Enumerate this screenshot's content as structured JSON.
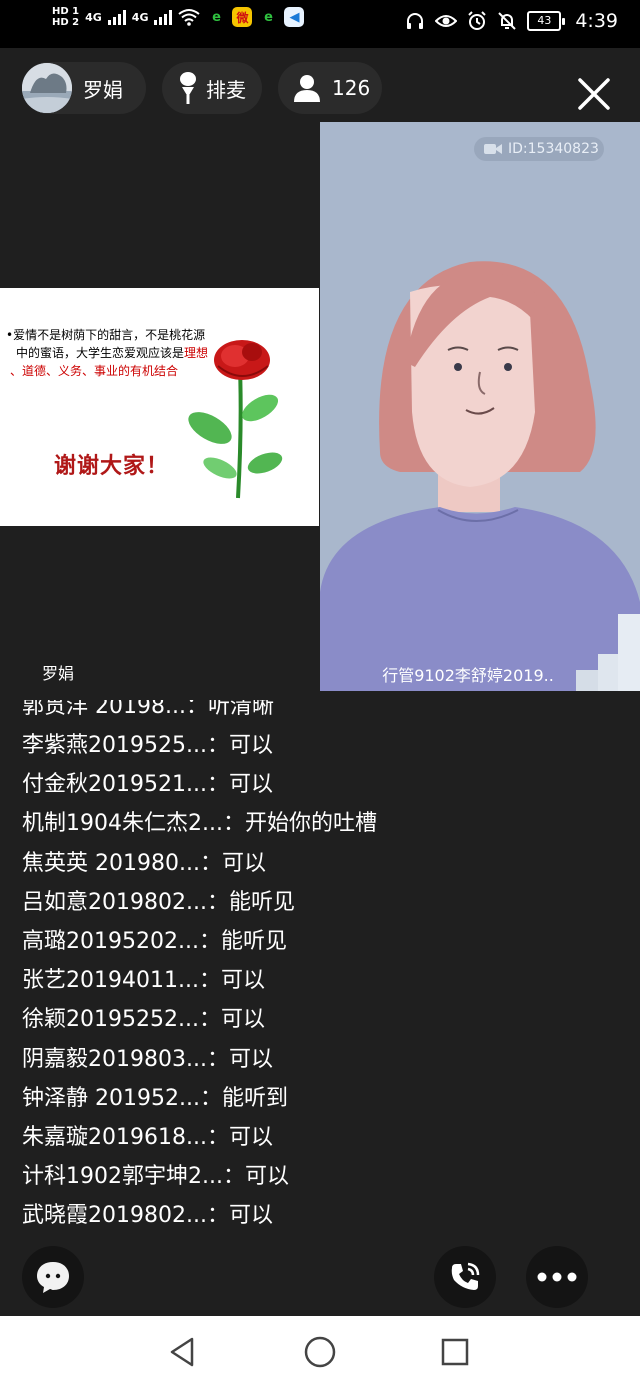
{
  "status_bar": {
    "hd1": "HD 1",
    "hd2": "HD 2",
    "network1": "4G",
    "network2": "4G",
    "battery": "43",
    "time": "4:39",
    "icons": [
      "headphones-icon",
      "eye-icon",
      "alarm-icon",
      "mute-bell-icon"
    ]
  },
  "header": {
    "host_name": "罗娟",
    "queue_label": "排麦",
    "viewer_count": "126"
  },
  "slide": {
    "line1": "•爱情不是树荫下的甜言，不是桃花源",
    "line2": "中的蜜语，大学生恋爱观应该是",
    "line2_red": "理想",
    "line3_red": "、道德、义务、事业的有机结合",
    "thanks": "谢谢大家！",
    "host_label": "罗娟"
  },
  "video": {
    "id_text": "ID:15340823",
    "participant_name": "行管9102李舒婷2019.."
  },
  "chat": {
    "partial_line": "郭贯洋 20198...：听清晰",
    "messages": [
      {
        "user": "李紫燕2019525...",
        "text": "可以"
      },
      {
        "user": "付金秋2019521...",
        "text": "可以"
      },
      {
        "user": "机制1904朱仁杰2...",
        "text": "开始你的吐槽"
      },
      {
        "user": "焦英英 201980...",
        "text": "可以"
      },
      {
        "user": "吕如意2019802...",
        "text": "能听见"
      },
      {
        "user": "高璐20195202...",
        "text": "能听见"
      },
      {
        "user": "张艺20194011...",
        "text": "可以"
      },
      {
        "user": "徐颖20195252...",
        "text": "可以"
      },
      {
        "user": "阴嘉毅2019803...",
        "text": "可以"
      },
      {
        "user": "钟泽静 201952...",
        "text": "能听到"
      },
      {
        "user": "朱嘉璇2019618...",
        "text": "可以"
      },
      {
        "user": "计科1902郭宇坤2...",
        "text": "可以"
      },
      {
        "user": "武晓霞2019802...",
        "text": "可以"
      }
    ],
    "separator": "："
  },
  "colors": {
    "background": "#1f1f1f",
    "pill": "#2b2b2b",
    "slide_red": "#b01818",
    "video_bg": "#a9b7cc"
  }
}
